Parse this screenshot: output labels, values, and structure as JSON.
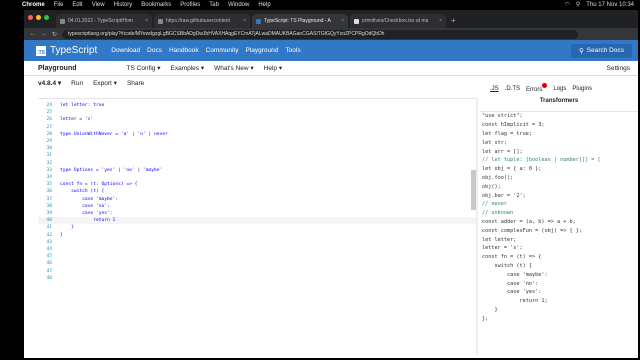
{
  "menubar": {
    "app": "Chrome",
    "items": [
      "File",
      "Edit",
      "View",
      "History",
      "Bookmarks",
      "Profiles",
      "Tab",
      "Window",
      "Help"
    ],
    "datetime": "Thu 17 Nov  10:34"
  },
  "browser": {
    "tabs": [
      {
        "title": "04.01.2022 - TypeScript/Hom",
        "active": false
      },
      {
        "title": "https://raw.githubusercontent",
        "active": false
      },
      {
        "title": "TypeScript: TS Playground - A",
        "active": true
      },
      {
        "title": "primitives/Checkbox.tsx at ma",
        "active": false
      }
    ],
    "url": "typescriptlang.org/play?#code/MYewdgzgLgBGCSBbADgDwJbHVAXHAqgEYCmATjALwaDMAUKBAGaoCGASITGfGQyYxoZPCPRgOdQbDh"
  },
  "ts": {
    "brand": "TypeScript",
    "logo": "TS",
    "nav": [
      "Download",
      "Docs",
      "Handbook",
      "Community",
      "Playground",
      "Tools"
    ],
    "search": "Search Docs",
    "playground_title": "Playground",
    "menu": [
      "TS Config ▾",
      "Examples ▾",
      "What's New ▾",
      "Help ▾"
    ],
    "settings": "Settings",
    "version": "v4.8.4 ▾",
    "run": "Run",
    "export": "Export ▾",
    "share": "Share"
  },
  "editor_lines": [
    {
      "n": "24",
      "code": "let letter: true"
    },
    {
      "n": "25",
      "code": ""
    },
    {
      "n": "26",
      "code": "letter = 's'"
    },
    {
      "n": "27",
      "code": ""
    },
    {
      "n": "28",
      "code": "type UnionWithNever = 'a' | 'n' | never"
    },
    {
      "n": "29",
      "code": ""
    },
    {
      "n": "30",
      "code": ""
    },
    {
      "n": "31",
      "code": ""
    },
    {
      "n": "32",
      "code": ""
    },
    {
      "n": "33",
      "code": "type Options = 'yes' | 'no' | 'maybe'"
    },
    {
      "n": "34",
      "code": ""
    },
    {
      "n": "35",
      "code": "const fn = (t: Options) => {"
    },
    {
      "n": "36",
      "code": "    switch (t) {"
    },
    {
      "n": "37",
      "code": "        case 'maybe':"
    },
    {
      "n": "38",
      "code": "        case 'no':"
    },
    {
      "n": "39",
      "code": "        case 'yes':"
    },
    {
      "n": "40",
      "code": "            return 1"
    },
    {
      "n": "41",
      "code": "    }"
    },
    {
      "n": "42",
      "code": "}"
    },
    {
      "n": "43",
      "code": ""
    },
    {
      "n": "44",
      "code": ""
    },
    {
      "n": "45",
      "code": ""
    },
    {
      "n": "46",
      "code": ""
    },
    {
      "n": "47",
      "code": ""
    },
    {
      "n": "48",
      "code": ""
    }
  ],
  "right": {
    "tabs": [
      ".JS",
      ".D.TS",
      "Errors",
      "Logs",
      "Plugins"
    ],
    "subtitle": "Transformers",
    "output": [
      "\"use strict\";",
      "const hImplicit = 3;",
      "let flag = true;",
      "let str;",
      "let arr = [];",
      "// let tuple: [boolean | number][] = [",
      "let obj = { a: 0 };",
      "obj.foo();",
      "obj();",
      "obj.bar = '2';",
      "// never",
      "// unknown",
      "const adder = (a, b) => a + b;",
      "const complexFun = (obj) => { };",
      "let letter;",
      "letter = 's';",
      "const fn = (t) => {",
      "    switch (t) {",
      "        case 'maybe':",
      "        case 'no':",
      "        case 'yes':",
      "            return 1;",
      "    }",
      "};"
    ]
  }
}
